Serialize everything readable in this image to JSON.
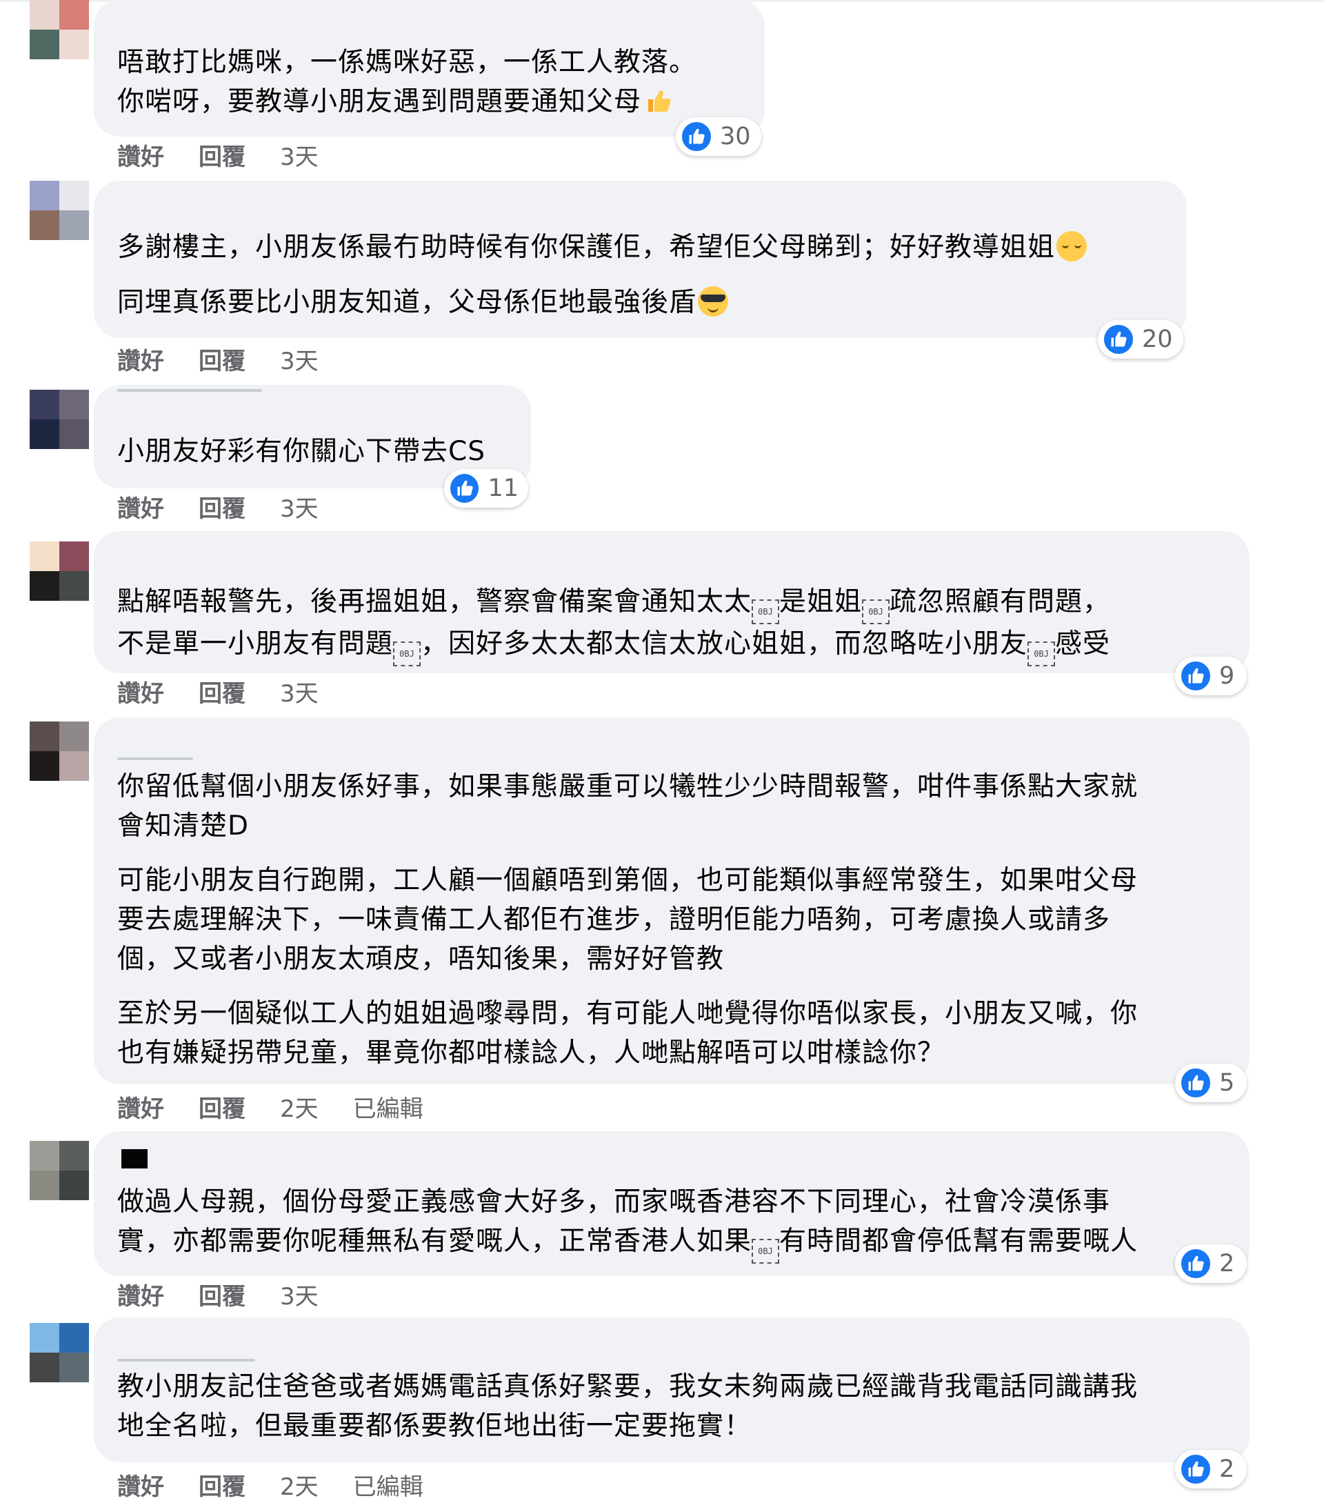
{
  "action_labels": {
    "like": "讚好",
    "reply": "回覆",
    "edited": "已編輯"
  },
  "colors": {
    "bubble_bg": "#f0f2f5",
    "like_blue": "#1877f2",
    "meta_gray": "#65676b",
    "text": "#050505"
  },
  "comments": [
    {
      "paragraphs": [
        "唔敢打比媽咪，一係媽咪好惡，一係工人教落。\n你啱呀，要教導小朋友遇到問題要通知父母"
      ],
      "trailing_emoji": "thumbs-up",
      "reaction_count": "30",
      "time": "3天",
      "edited": false
    },
    {
      "paragraphs": [
        "多謝樓主，小朋友係最冇助時候有你保護佢，希望佢父母睇到；好好教導姐姐",
        "同埋真係要比小朋友知道，父母係佢地最強後盾"
      ],
      "reaction_count": "20",
      "time": "3天",
      "edited": false
    },
    {
      "paragraphs": [
        "小朋友好彩有你關心下帶去CS"
      ],
      "reaction_count": "11",
      "time": "3天",
      "edited": false
    },
    {
      "line1_parts": [
        "點解唔報警先，後再搵姐姐，警察會備案會通知太太",
        "是姐姐",
        "疏忽照顧有問題，"
      ],
      "line2_parts": [
        "不是單一小朋友有問題",
        "，因好多太太都太信太放心姐姐，而忽略咗小朋友",
        "感受"
      ],
      "missing_glyph_code": "0BJ",
      "reaction_count": "9",
      "time": "3天",
      "edited": false
    },
    {
      "paragraphs": [
        "你留低幫個小朋友係好事，如果事態嚴重可以犧牲少少時間報警，咁件事係點大家就\n會知清楚D",
        "可能小朋友自行跑開，工人顧一個顧唔到第個，也可能類似事經常發生，如果咁父母\n要去處理解決下，一味責備工人都佢冇進步，證明佢能力唔夠，可考慮換人或請多\n個，又或者小朋友太頑皮，唔知後果，需好好管教",
        "至於另一個疑似工人的姐姐過嚟尋問，有可能人哋覺得你唔似家長，小朋友又喊，你\n也有嫌疑拐帶兒童，畢竟你都咁樣諗人，人哋點解唔可以咁樣諗你？"
      ],
      "reaction_count": "5",
      "time": "2天",
      "edited": true
    },
    {
      "line1": "做過人母親，個份母愛正義感會大好多，而家嘅香港容不下同理心，社會冷漠係事",
      "line2_parts": [
        "實，亦都需要你呢種無私有愛嘅人，正常香港人如果",
        "有時間都會停低幫有需要嘅人"
      ],
      "missing_glyph_code": "0BJ",
      "reaction_count": "2",
      "time": "3天",
      "edited": false
    },
    {
      "paragraphs": [
        "教小朋友記住爸爸或者媽媽電話真係好緊要，我女未夠兩歲已經識背我電話同識講我\n地全名啦，但最重要都係要教佢地出街一定要拖實！"
      ],
      "reaction_count": "2",
      "time": "2天",
      "edited": true
    }
  ]
}
